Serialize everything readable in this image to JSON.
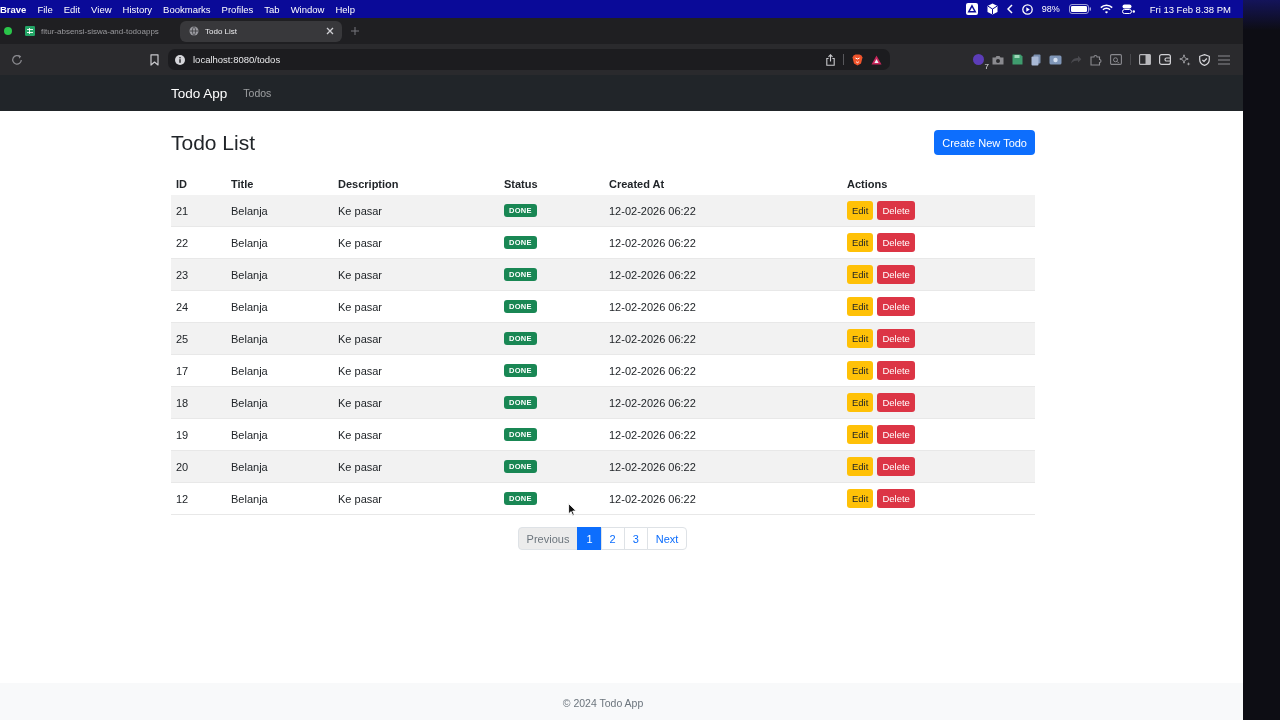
{
  "menu_bar": {
    "app": "Brave",
    "menus": [
      "File",
      "Edit",
      "View",
      "History",
      "Bookmarks",
      "Profiles",
      "Tab",
      "Window",
      "Help"
    ],
    "battery": "98%",
    "clock": "Fri 13 Feb 8.38 PM"
  },
  "browser": {
    "tabs": [
      {
        "title": "fitur-absensi-siswa-and-todoapps",
        "kind": "spreadsheet",
        "selected": false
      },
      {
        "title": "Todo List",
        "kind": "page",
        "selected": true
      }
    ],
    "url": "localhost:8080/todos",
    "extension_badge": "7"
  },
  "navbar": {
    "brand": "Todo App",
    "links": [
      {
        "label": "Todos",
        "selected": false
      }
    ]
  },
  "page": {
    "title": "Todo List",
    "create_button": "Create New Todo"
  },
  "table": {
    "columns": [
      "ID",
      "Title",
      "Description",
      "Status",
      "Created At",
      "Actions"
    ],
    "rows": [
      {
        "id": "21",
        "title": "Belanja",
        "description": "Ke pasar",
        "status": "DONE",
        "created_at": "12-02-2026 06:22",
        "actions": [
          {
            "label": "Edit",
            "kind": "edit"
          },
          {
            "label": "Delete",
            "kind": "delete"
          }
        ]
      },
      {
        "id": "22",
        "title": "Belanja",
        "description": "Ke pasar",
        "status": "DONE",
        "created_at": "12-02-2026 06:22",
        "actions": [
          {
            "label": "Edit",
            "kind": "edit"
          },
          {
            "label": "Delete",
            "kind": "delete"
          }
        ]
      },
      {
        "id": "23",
        "title": "Belanja",
        "description": "Ke pasar",
        "status": "DONE",
        "created_at": "12-02-2026 06:22",
        "actions": [
          {
            "label": "Edit",
            "kind": "edit"
          },
          {
            "label": "Delete",
            "kind": "delete"
          }
        ]
      },
      {
        "id": "24",
        "title": "Belanja",
        "description": "Ke pasar",
        "status": "DONE",
        "created_at": "12-02-2026 06:22",
        "actions": [
          {
            "label": "Edit",
            "kind": "edit"
          },
          {
            "label": "Delete",
            "kind": "delete"
          }
        ]
      },
      {
        "id": "25",
        "title": "Belanja",
        "description": "Ke pasar",
        "status": "DONE",
        "created_at": "12-02-2026 06:22",
        "actions": [
          {
            "label": "Edit",
            "kind": "edit"
          },
          {
            "label": "Delete",
            "kind": "delete"
          }
        ]
      },
      {
        "id": "17",
        "title": "Belanja",
        "description": "Ke pasar",
        "status": "DONE",
        "created_at": "12-02-2026 06:22",
        "actions": [
          {
            "label": "Edit",
            "kind": "edit"
          },
          {
            "label": "Delete",
            "kind": "delete"
          }
        ]
      },
      {
        "id": "18",
        "title": "Belanja",
        "description": "Ke pasar",
        "status": "DONE",
        "created_at": "12-02-2026 06:22",
        "actions": [
          {
            "label": "Edit",
            "kind": "edit"
          },
          {
            "label": "Delete",
            "kind": "delete"
          }
        ]
      },
      {
        "id": "19",
        "title": "Belanja",
        "description": "Ke pasar",
        "status": "DONE",
        "created_at": "12-02-2026 06:22",
        "actions": [
          {
            "label": "Edit",
            "kind": "edit"
          },
          {
            "label": "Delete",
            "kind": "delete"
          }
        ]
      },
      {
        "id": "20",
        "title": "Belanja",
        "description": "Ke pasar",
        "status": "DONE",
        "created_at": "12-02-2026 06:22",
        "actions": [
          {
            "label": "Edit",
            "kind": "edit"
          },
          {
            "label": "Delete",
            "kind": "delete"
          }
        ]
      },
      {
        "id": "12",
        "title": "Belanja",
        "description": "Ke pasar",
        "status": "DONE",
        "created_at": "12-02-2026 06:22",
        "actions": [
          {
            "label": "Edit",
            "kind": "edit"
          },
          {
            "label": "Delete",
            "kind": "delete"
          }
        ]
      }
    ]
  },
  "pagination": {
    "previous": {
      "label": "Previous",
      "disabled": true
    },
    "pages": [
      {
        "label": "1",
        "selected": true
      },
      {
        "label": "2",
        "selected": false
      },
      {
        "label": "3",
        "selected": false
      }
    ],
    "next": {
      "label": "Next",
      "disabled": false
    }
  },
  "footer": {
    "text": "© 2024 Todo App"
  }
}
